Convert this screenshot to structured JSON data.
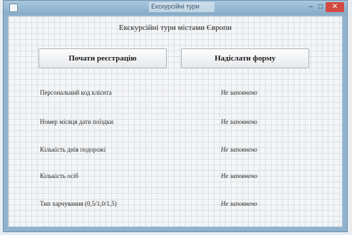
{
  "window": {
    "title": "Екскурсійні тури"
  },
  "form": {
    "title": "Екскурсійні тури містами Європи",
    "register_button": "Почати реєстрацію",
    "submit_button": "Надіслати форму",
    "fields": [
      {
        "label": "Персональний код клієнта",
        "value": "Не заповнено"
      },
      {
        "label": "Номер місяця дати поїздки",
        "value": "Не заповнено"
      },
      {
        "label": "Кількість днів подорожі",
        "value": "Не заповнено"
      },
      {
        "label": "Кількість осіб",
        "value": "Не заповнено"
      },
      {
        "label": "Тип харчування (0,5/1,0/1,5)",
        "value": "Не заповнено"
      }
    ]
  }
}
